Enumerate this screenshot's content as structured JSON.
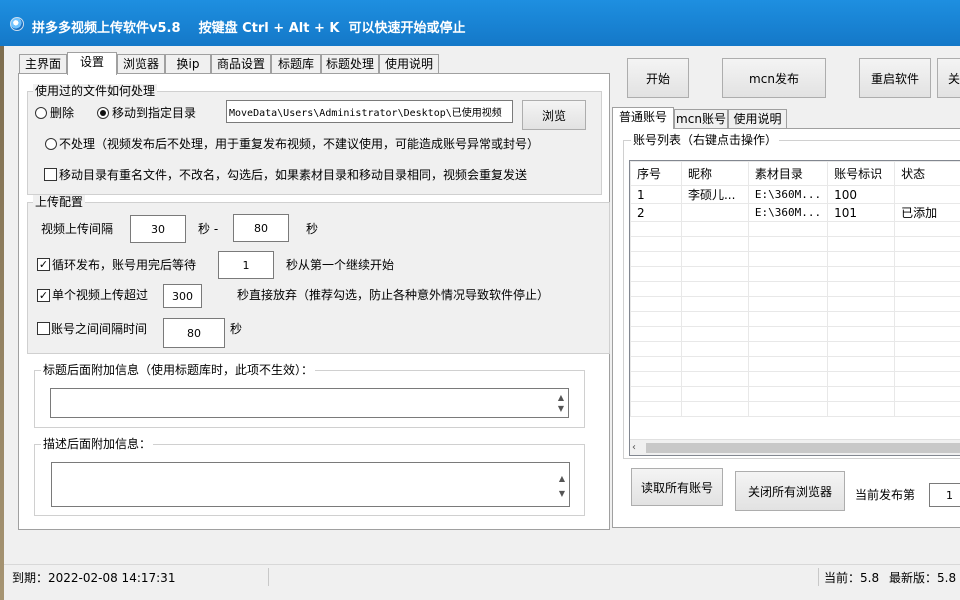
{
  "window": {
    "title": "拼多多视频上传软件v5.8    按键盘 Ctrl + Alt + K  可以快速开始或停止"
  },
  "tabs": [
    "主界面",
    "设置",
    "浏览器",
    "换ip",
    "商品设置",
    "标题库",
    "标题处理",
    "使用说明"
  ],
  "active_tab": "设置",
  "used_files": {
    "group_title": "使用过的文件如何处理",
    "radio_delete": "删除",
    "radio_move": "移动到指定目录",
    "move_path": "MoveData\\Users\\Administrator\\Desktop\\已使用视频",
    "browse_label": "浏览",
    "radio_none": "不处理（视频发布后不处理，用于重复发布视频，不建议使用，可能造成账号异常或封号）",
    "rename_check": "移动目录有重名文件，不改名，勾选后，如果素材目录和移动目录相同，视频会重复发送",
    "selected": "move"
  },
  "upload_config": {
    "group_title": "上传配置",
    "interval_label": "视频上传间隔",
    "interval_min": "30",
    "sec1": "秒 -",
    "interval_max": "80",
    "sec2": "秒",
    "loop_label": "循环发布，账号用完后等待",
    "loop_value": "1",
    "loop_suffix": "秒从第一个继续开始",
    "single_label": "单个视频上传超过",
    "single_value": "300",
    "single_suffix": "秒直接放弃（推荐勾选，防止各种意外情况导致软件停止）",
    "account_label": "账号之间间隔时间",
    "account_value": "80",
    "account_suffix": "秒",
    "loop_checked": true,
    "single_checked": true,
    "account_checked": false
  },
  "title_extra": {
    "label": "标题后面附加信息（使用标题库时，此项不生效）：",
    "value": ""
  },
  "desc_extra": {
    "label": "描述后面附加信息：",
    "value": ""
  },
  "top_buttons": {
    "start": "开始",
    "mcn": "mcn发布",
    "restart": "重启软件",
    "more": "关"
  },
  "right_tabs": [
    "普通账号",
    "mcn账号",
    "使用说明"
  ],
  "right_active_tab": "普通账号",
  "accounts": {
    "group_title": "账号列表（右键点击操作）",
    "columns": [
      "序号",
      "昵称",
      "素材目录",
      "账号标识",
      "状态"
    ],
    "rows": [
      [
        "1",
        "李硕儿...",
        "E:\\360M...",
        "100",
        ""
      ],
      [
        "2",
        "",
        "E:\\360M...",
        "101",
        "已添加"
      ]
    ]
  },
  "bottom_buttons": {
    "read_all": "读取所有账号",
    "close_browsers": "关闭所有浏览器"
  },
  "current_publish": {
    "label": "当前发布第",
    "value": "1"
  },
  "status": {
    "expiry": "到期：2022-02-08 14:17:31",
    "current": "当前：5.8",
    "latest": "最新版：5.8"
  }
}
